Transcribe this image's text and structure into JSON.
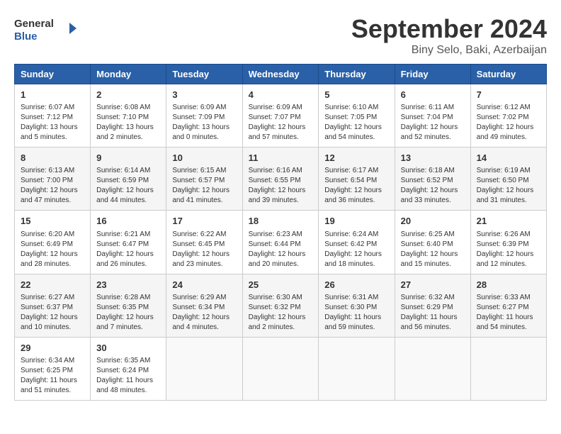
{
  "header": {
    "logo_line1": "General",
    "logo_line2": "Blue",
    "month_title": "September 2024",
    "subtitle": "Biny Selo, Baki, Azerbaijan"
  },
  "weekdays": [
    "Sunday",
    "Monday",
    "Tuesday",
    "Wednesday",
    "Thursday",
    "Friday",
    "Saturday"
  ],
  "weeks": [
    [
      {
        "day": "1",
        "info": "Sunrise: 6:07 AM\nSunset: 7:12 PM\nDaylight: 13 hours and 5 minutes."
      },
      {
        "day": "2",
        "info": "Sunrise: 6:08 AM\nSunset: 7:10 PM\nDaylight: 13 hours and 2 minutes."
      },
      {
        "day": "3",
        "info": "Sunrise: 6:09 AM\nSunset: 7:09 PM\nDaylight: 13 hours and 0 minutes."
      },
      {
        "day": "4",
        "info": "Sunrise: 6:09 AM\nSunset: 7:07 PM\nDaylight: 12 hours and 57 minutes."
      },
      {
        "day": "5",
        "info": "Sunrise: 6:10 AM\nSunset: 7:05 PM\nDaylight: 12 hours and 54 minutes."
      },
      {
        "day": "6",
        "info": "Sunrise: 6:11 AM\nSunset: 7:04 PM\nDaylight: 12 hours and 52 minutes."
      },
      {
        "day": "7",
        "info": "Sunrise: 6:12 AM\nSunset: 7:02 PM\nDaylight: 12 hours and 49 minutes."
      }
    ],
    [
      {
        "day": "8",
        "info": "Sunrise: 6:13 AM\nSunset: 7:00 PM\nDaylight: 12 hours and 47 minutes."
      },
      {
        "day": "9",
        "info": "Sunrise: 6:14 AM\nSunset: 6:59 PM\nDaylight: 12 hours and 44 minutes."
      },
      {
        "day": "10",
        "info": "Sunrise: 6:15 AM\nSunset: 6:57 PM\nDaylight: 12 hours and 41 minutes."
      },
      {
        "day": "11",
        "info": "Sunrise: 6:16 AM\nSunset: 6:55 PM\nDaylight: 12 hours and 39 minutes."
      },
      {
        "day": "12",
        "info": "Sunrise: 6:17 AM\nSunset: 6:54 PM\nDaylight: 12 hours and 36 minutes."
      },
      {
        "day": "13",
        "info": "Sunrise: 6:18 AM\nSunset: 6:52 PM\nDaylight: 12 hours and 33 minutes."
      },
      {
        "day": "14",
        "info": "Sunrise: 6:19 AM\nSunset: 6:50 PM\nDaylight: 12 hours and 31 minutes."
      }
    ],
    [
      {
        "day": "15",
        "info": "Sunrise: 6:20 AM\nSunset: 6:49 PM\nDaylight: 12 hours and 28 minutes."
      },
      {
        "day": "16",
        "info": "Sunrise: 6:21 AM\nSunset: 6:47 PM\nDaylight: 12 hours and 26 minutes."
      },
      {
        "day": "17",
        "info": "Sunrise: 6:22 AM\nSunset: 6:45 PM\nDaylight: 12 hours and 23 minutes."
      },
      {
        "day": "18",
        "info": "Sunrise: 6:23 AM\nSunset: 6:44 PM\nDaylight: 12 hours and 20 minutes."
      },
      {
        "day": "19",
        "info": "Sunrise: 6:24 AM\nSunset: 6:42 PM\nDaylight: 12 hours and 18 minutes."
      },
      {
        "day": "20",
        "info": "Sunrise: 6:25 AM\nSunset: 6:40 PM\nDaylight: 12 hours and 15 minutes."
      },
      {
        "day": "21",
        "info": "Sunrise: 6:26 AM\nSunset: 6:39 PM\nDaylight: 12 hours and 12 minutes."
      }
    ],
    [
      {
        "day": "22",
        "info": "Sunrise: 6:27 AM\nSunset: 6:37 PM\nDaylight: 12 hours and 10 minutes."
      },
      {
        "day": "23",
        "info": "Sunrise: 6:28 AM\nSunset: 6:35 PM\nDaylight: 12 hours and 7 minutes."
      },
      {
        "day": "24",
        "info": "Sunrise: 6:29 AM\nSunset: 6:34 PM\nDaylight: 12 hours and 4 minutes."
      },
      {
        "day": "25",
        "info": "Sunrise: 6:30 AM\nSunset: 6:32 PM\nDaylight: 12 hours and 2 minutes."
      },
      {
        "day": "26",
        "info": "Sunrise: 6:31 AM\nSunset: 6:30 PM\nDaylight: 11 hours and 59 minutes."
      },
      {
        "day": "27",
        "info": "Sunrise: 6:32 AM\nSunset: 6:29 PM\nDaylight: 11 hours and 56 minutes."
      },
      {
        "day": "28",
        "info": "Sunrise: 6:33 AM\nSunset: 6:27 PM\nDaylight: 11 hours and 54 minutes."
      }
    ],
    [
      {
        "day": "29",
        "info": "Sunrise: 6:34 AM\nSunset: 6:25 PM\nDaylight: 11 hours and 51 minutes."
      },
      {
        "day": "30",
        "info": "Sunrise: 6:35 AM\nSunset: 6:24 PM\nDaylight: 11 hours and 48 minutes."
      },
      {
        "day": "",
        "info": ""
      },
      {
        "day": "",
        "info": ""
      },
      {
        "day": "",
        "info": ""
      },
      {
        "day": "",
        "info": ""
      },
      {
        "day": "",
        "info": ""
      }
    ]
  ]
}
